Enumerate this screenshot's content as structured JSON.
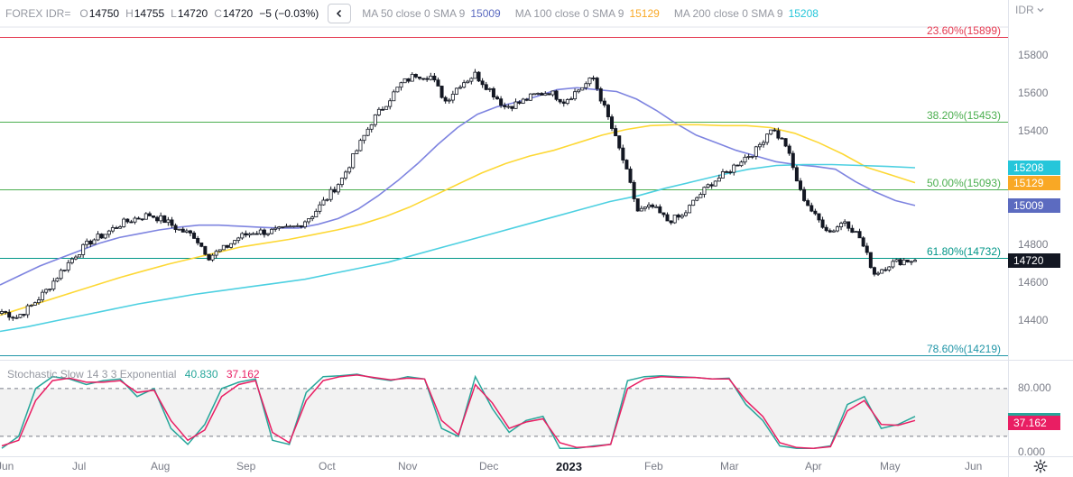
{
  "header": {
    "symbol": "FOREX IDR=",
    "open_key": "O",
    "open": "14750",
    "high_key": "H",
    "high": "14755",
    "low_key": "L",
    "low": "14720",
    "close_key": "C",
    "close": "14720",
    "change": "−5 (−0.03%)",
    "ma50_label": "MA 50 close 0 SMA 9",
    "ma50_value": "15009",
    "ma100_label": "MA 100 close 0 SMA 9",
    "ma100_value": "15129",
    "ma200_label": "MA 200 close 0 SMA 9",
    "ma200_value": "15208",
    "collapse_icon": "chevron-left-icon"
  },
  "price_scale": {
    "currency_label": "IDR",
    "currency_icon": "chevron-down-icon"
  },
  "stoch_header": {
    "label": "Stochastic Slow 14 3 3 Exponential",
    "k_value": "40.830",
    "d_value": "37.162"
  },
  "settings_icon": "gear-icon",
  "colors": {
    "up": "#131722",
    "down": "#131722",
    "ma50": "#7e84e0",
    "ma100": "#fdd835",
    "ma200": "#4dd0e1",
    "stoch_k": "#26a69a",
    "stoch_d": "#e91e63",
    "fib_236": "#e53950",
    "fib_382": "#4caf50",
    "fib_500": "#4caf50",
    "fib_618": "#009688",
    "fib_786": "#2196a8"
  },
  "price_tags": [
    {
      "value": "15208",
      "color": "#26c6da"
    },
    {
      "value": "15129",
      "color": "#f9a825"
    },
    {
      "value": "15009",
      "color": "#5c6bc0"
    },
    {
      "value": "14720",
      "color": "#131722"
    }
  ],
  "stoch_tags": [
    {
      "value": "40.830",
      "color": "#26a69a"
    },
    {
      "value": "37.162",
      "color": "#e91e63"
    }
  ],
  "chart_data": {
    "type": "candlestick",
    "symbol": "FOREX IDR=",
    "x_axis_labels": [
      "Jun",
      "Jul",
      "Aug",
      "Sep",
      "Oct",
      "Nov",
      "Dec",
      "2023",
      "Feb",
      "Mar",
      "Apr",
      "May",
      "Jun"
    ],
    "y_axis": {
      "range": [
        14200,
        15950
      ],
      "ticks": [
        14400,
        14600,
        14800,
        15000,
        15200,
        15400,
        15600,
        15800
      ]
    },
    "stoch_axis": {
      "range": [
        -5,
        115
      ],
      "ticks": [
        "80.000",
        "0.000"
      ],
      "tick_values": [
        80,
        0
      ],
      "band": [
        20,
        80
      ]
    },
    "last": {
      "open": 14750,
      "high": 14755,
      "low": 14720,
      "close": 14720,
      "change": -5,
      "change_pct": -0.03
    },
    "fib_levels": [
      {
        "label": "23.60%(15899)",
        "ratio": "23.60%",
        "price": 15899
      },
      {
        "label": "38.20%(15453)",
        "ratio": "38.20%",
        "price": 15453
      },
      {
        "label": "50.00%(15093)",
        "ratio": "50.00%",
        "price": 15093
      },
      {
        "label": "61.80%(14732)",
        "ratio": "61.80%",
        "price": 14732
      },
      {
        "label": "78.60%(14219)",
        "ratio": "78.60%",
        "price": 14219
      }
    ],
    "closes_weekly_approx": [
      14450,
      14420,
      14480,
      14560,
      14660,
      14750,
      14820,
      14860,
      14910,
      14940,
      14960,
      14930,
      14880,
      14850,
      14740,
      14780,
      14840,
      14870,
      14870,
      14880,
      14900,
      14960,
      15050,
      15150,
      15300,
      15450,
      15550,
      15650,
      15700,
      15690,
      15560,
      15650,
      15700,
      15620,
      15530,
      15550,
      15590,
      15610,
      15560,
      15620,
      15680,
      15470,
      15250,
      14980,
      15000,
      14930,
      14950,
      15050,
      15130,
      15180,
      15250,
      15300,
      15420,
      15330,
      15080,
      14950,
      14870,
      14930,
      14840,
      14650,
      14700,
      14720
    ],
    "series": [
      {
        "name": "MA 50 close 0 SMA 9",
        "last": 15009,
        "values": [
          14590,
          14640,
          14690,
          14730,
          14770,
          14810,
          14840,
          14860,
          14880,
          14895,
          14905,
          14905,
          14900,
          14895,
          14890,
          14890,
          14910,
          14940,
          14990,
          15060,
          15140,
          15230,
          15330,
          15420,
          15490,
          15530,
          15555,
          15585,
          15620,
          15630,
          15620,
          15610,
          15570,
          15510,
          15440,
          15380,
          15340,
          15300,
          15270,
          15240,
          15225,
          15215,
          15200,
          15135,
          15080,
          15035,
          15009
        ]
      },
      {
        "name": "MA 100 close 0 SMA 9",
        "last": 15129,
        "values": [
          14430,
          14470,
          14510,
          14550,
          14590,
          14630,
          14665,
          14700,
          14730,
          14760,
          14790,
          14810,
          14830,
          14855,
          14880,
          14910,
          14950,
          15000,
          15060,
          15120,
          15180,
          15230,
          15270,
          15300,
          15340,
          15380,
          15410,
          15430,
          15435,
          15435,
          15430,
          15430,
          15420,
          15390,
          15340,
          15280,
          15210,
          15170,
          15129
        ]
      },
      {
        "name": "MA 200 close 0 SMA 9",
        "last": 15208,
        "values": [
          14345,
          14370,
          14400,
          14430,
          14460,
          14490,
          14515,
          14540,
          14560,
          14580,
          14600,
          14620,
          14650,
          14680,
          14710,
          14750,
          14790,
          14830,
          14870,
          14910,
          14950,
          14990,
          15030,
          15060,
          15100,
          15135,
          15170,
          15200,
          15220,
          15225,
          15225,
          15220,
          15215,
          15208
        ]
      },
      {
        "name": "Stochastic %K",
        "last": 40.83,
        "values": [
          5,
          20,
          80,
          95,
          92,
          85,
          90,
          92,
          70,
          80,
          30,
          10,
          35,
          80,
          88,
          92,
          15,
          10,
          75,
          95,
          96,
          98,
          93,
          90,
          95,
          92,
          30,
          20,
          95,
          55,
          25,
          40,
          45,
          5,
          5,
          8,
          10,
          90,
          95,
          96,
          95,
          94,
          92,
          93,
          60,
          40,
          8,
          5,
          5,
          8,
          60,
          70,
          30,
          35,
          45
        ]
      },
      {
        "name": "Stochastic %D",
        "last": 37.162,
        "values": [
          8,
          15,
          65,
          90,
          93,
          88,
          88,
          90,
          75,
          78,
          40,
          15,
          28,
          70,
          85,
          90,
          25,
          12,
          65,
          90,
          95,
          97,
          94,
          91,
          93,
          92,
          40,
          22,
          85,
          62,
          30,
          38,
          42,
          12,
          6,
          7,
          10,
          80,
          92,
          95,
          94,
          94,
          92,
          92,
          65,
          45,
          12,
          6,
          5,
          7,
          52,
          65,
          35,
          34,
          40
        ]
      }
    ],
    "xlabel": "",
    "ylabel": "",
    "grid": false
  }
}
